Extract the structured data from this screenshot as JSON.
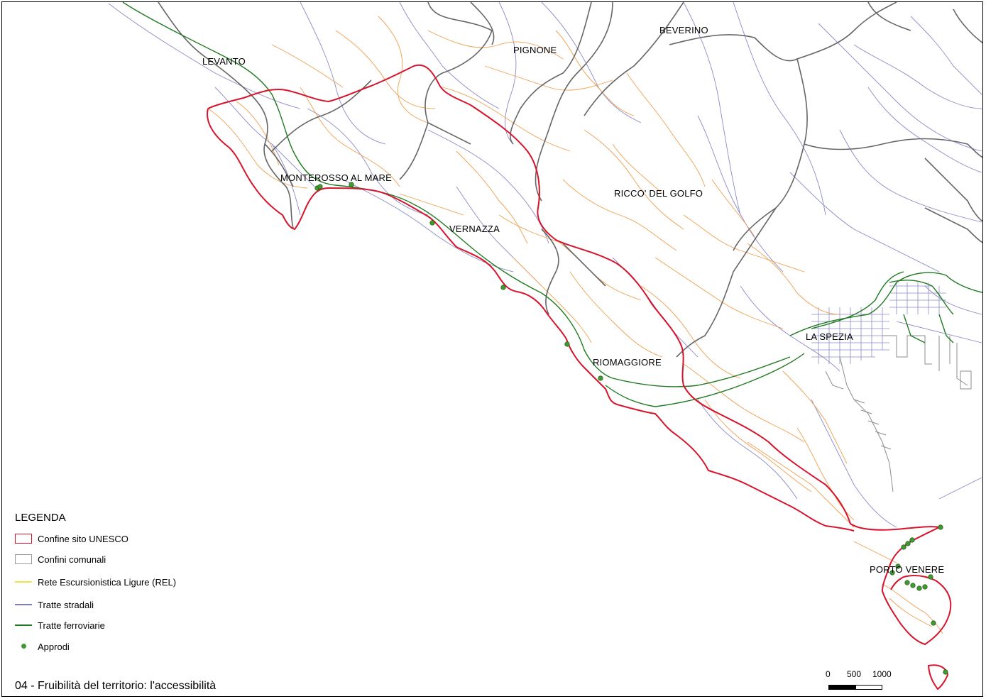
{
  "places": [
    {
      "name": "LEVANTO"
    },
    {
      "name": "PIGNONE"
    },
    {
      "name": "BEVERINO"
    },
    {
      "name": "MONTEROSSO AL MARE"
    },
    {
      "name": "RICCO' DEL GOLFO"
    },
    {
      "name": "VERNAZZA"
    },
    {
      "name": "LA SPEZIA"
    },
    {
      "name": "RIOMAGGIORE"
    },
    {
      "name": "PORTO VENERE"
    }
  ],
  "legend": {
    "title": "LEGENDA",
    "items": [
      {
        "label": "Confine sito UNESCO",
        "color": "#d6142b",
        "kind": "box"
      },
      {
        "label": "Confini comunali",
        "color": "#9a9a9a",
        "kind": "box"
      },
      {
        "label": "Rete Escursionistica Ligure (REL)",
        "color": "#f3e04b",
        "kind": "line"
      },
      {
        "label": "Tratte stradali",
        "color": "#7f7fbf",
        "kind": "line"
      },
      {
        "label": "Tratte ferroviarie",
        "color": "#217a21",
        "kind": "line"
      },
      {
        "label": "Approdi",
        "color": "#3f9a2f",
        "kind": "dot"
      }
    ]
  },
  "map_title": "04 - Fruibilità del territorio: l'accessibilità",
  "scale": {
    "ticks": [
      "0",
      "500",
      "1000"
    ]
  },
  "colors": {
    "unesco_boundary": "#d6142b",
    "municipal_boundary": "#666666",
    "hiking_trails": "#f0a050",
    "roads": "#8a8ac8",
    "railways": "#217a21",
    "landings": "#3f9a2f"
  }
}
